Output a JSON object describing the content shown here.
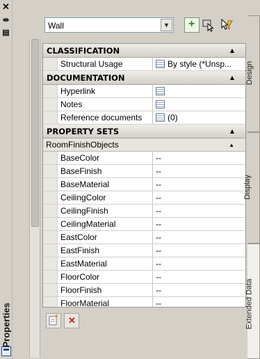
{
  "window": {
    "title": "Properties"
  },
  "toolbar": {
    "object_type": "Wall"
  },
  "categories": {
    "classification": "CLASSIFICATION",
    "documentation": "DOCUMENTATION",
    "property_sets": "PROPERTY SETS"
  },
  "classification": {
    "rows": [
      {
        "name": "Structural Usage",
        "value": "By style (*Unsp..."
      }
    ]
  },
  "documentation": {
    "rows": [
      {
        "name": "Hyperlink",
        "value": ""
      },
      {
        "name": "Notes",
        "value": ""
      },
      {
        "name": "Reference documents",
        "value": "(0)"
      }
    ]
  },
  "property_sets": {
    "group": "RoomFinishObjects",
    "rows": [
      {
        "name": "BaseColor",
        "value": "--"
      },
      {
        "name": "BaseFinish",
        "value": "--"
      },
      {
        "name": "BaseMaterial",
        "value": "--"
      },
      {
        "name": "CeilingColor",
        "value": "--"
      },
      {
        "name": "CeilingFinish",
        "value": "--"
      },
      {
        "name": "CeilingMaterial",
        "value": "--"
      },
      {
        "name": "EastColor",
        "value": "--"
      },
      {
        "name": "EastFinish",
        "value": "--"
      },
      {
        "name": "EastMaterial",
        "value": "--"
      },
      {
        "name": "FloorColor",
        "value": "--"
      },
      {
        "name": "FloorFinish",
        "value": "--"
      },
      {
        "name": "FloorMaterial",
        "value": "--"
      }
    ]
  },
  "tabs": {
    "design": "Design",
    "display": "Display",
    "extended": "Extended Data"
  },
  "colors": {
    "panel": "#d4d0c8",
    "category_header": "#d3d0c8",
    "accent_blue": "#2a4c88",
    "delete_red": "#c81a1a"
  }
}
